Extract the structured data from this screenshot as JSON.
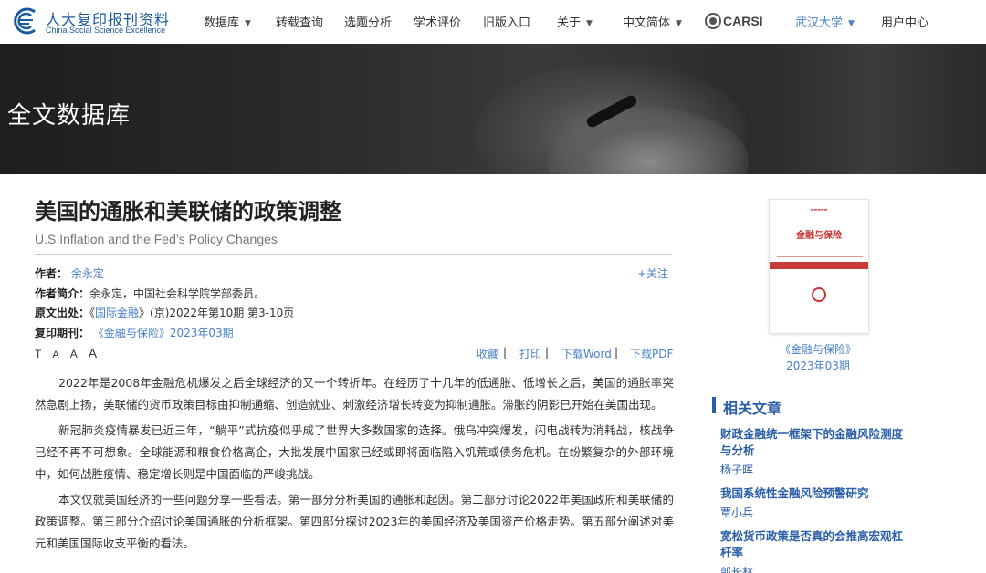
{
  "nav": {
    "logo_cn": "人大复印报刊资料",
    "logo_en": "China Social Science Excellence",
    "items": [
      {
        "label": "数据库",
        "dropdown": true
      },
      {
        "label": "转载查询",
        "dropdown": false
      },
      {
        "label": "选题分析",
        "dropdown": false
      },
      {
        "label": "学术评价",
        "dropdown": false
      },
      {
        "label": "旧版入口",
        "dropdown": false
      },
      {
        "label": "关于",
        "dropdown": true
      },
      {
        "label": "中文简体",
        "dropdown": true
      }
    ],
    "carsi": "CARSI",
    "institution": "武汉大学",
    "user_center": "用户中心"
  },
  "banner": {
    "title": "全文数据库"
  },
  "article": {
    "title": "美国的通胀和美联储的政策调整",
    "subtitle": "U.S.Inflation and the Fed’s Policy Changes",
    "author_label": "作者：",
    "author": "余永定",
    "follow": "+关注",
    "bio_label": "作者简介：",
    "bio": "余永定，中国社会科学院学部委员。",
    "source_label": "原文出处：",
    "source_prefix": "《",
    "source_link": "国际金融",
    "source_rest": "》(京)2022年第10期 第3-10页",
    "reprint_label": "复印期刊：",
    "reprint_link": "《金融与保险》2023年03期",
    "font_sizes": [
      "T",
      "A",
      "A",
      "A"
    ],
    "tools": [
      "收藏",
      "打印",
      "下载Word",
      "下载PDF"
    ],
    "tool_sep": "|",
    "paragraphs": [
      "2022年是2008年金融危机爆发之后全球经济的又一个转折年。在经历了十几年的低通胀、低增长之后，美国的通胀率突然急剧上扬，美联储的货币政策目标由抑制通缩、创造就业、刺激经济增长转变为抑制通胀。滞胀的阴影已开始在美国出现。",
      "新冠肺炎疫情暴发已近三年，“躺平”式抗疫似乎成了世界大多数国家的选择。俄乌冲突爆发，闪电战转为消耗战，核战争已经不再不可想象。全球能源和粮食价格高企，大批发展中国家已经或即将面临陷入饥荒或债务危机。在纷繁复杂的外部环境中，如何战胜疫情、稳定增长则是中国面临的严峻挑战。",
      "本文仅就美国经济的一些问题分享一些看法。第一部分分析美国的通胀和起因。第二部分讨论2022年美国政府和美联储的政策调整。第三部分介绍讨论美国通胀的分析框架。第四部分探讨2023年的美国经济及美国资产价格走势。第五部分阐述对美元和美国国际收支平衡的看法。"
    ]
  },
  "sidebar": {
    "cover": {
      "journal": "金融与保险",
      "caption_line1": "《金融与保险》",
      "caption_line2": "2023年03期"
    },
    "related_heading": "相关文章",
    "related": [
      {
        "title": "财政金融统一框架下的金融风险测度与分析",
        "author": "杨子晖"
      },
      {
        "title": "我国系统性金融风险预警研究",
        "author": "覃小兵"
      },
      {
        "title": "宽松货币政策是否真的会推高宏观杠杆率",
        "author": "郭长林"
      }
    ]
  },
  "colors": {
    "link": "#4a80c8",
    "heading_blue": "#2a5ea8",
    "cover_red": "#c93a3a"
  }
}
